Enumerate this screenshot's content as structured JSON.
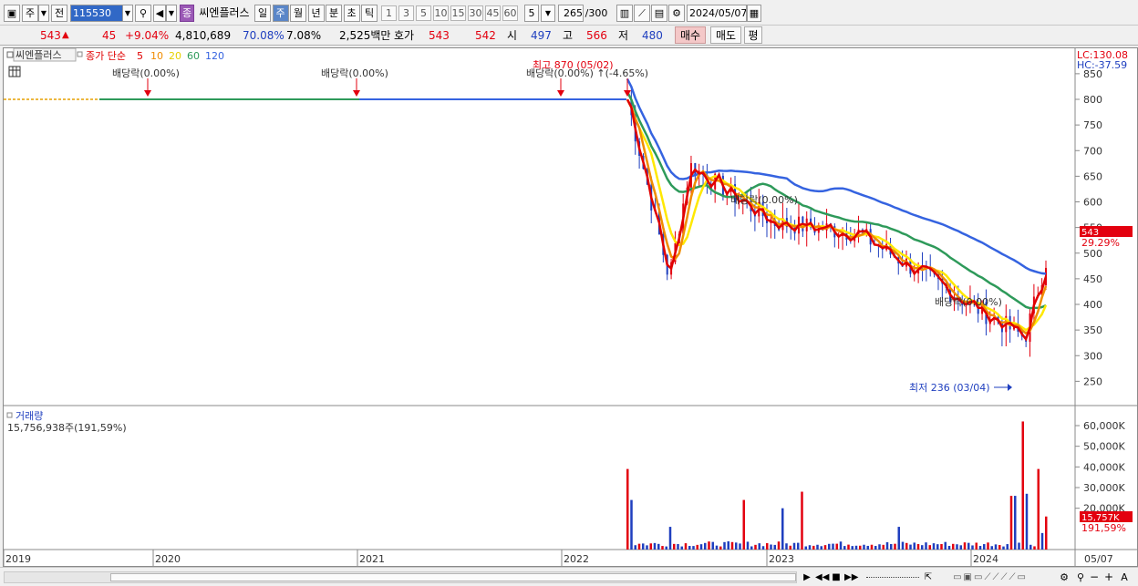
{
  "toolbar": {
    "market_label": "주",
    "prev_label": "전",
    "code": "115530",
    "company": "씨엔플러스",
    "company_badge": "종",
    "periods": [
      "일",
      "주",
      "월",
      "년",
      "분",
      "초",
      "틱"
    ],
    "active_period": "주",
    "numbers": [
      "1",
      "3",
      "5",
      "10",
      "15",
      "30",
      "45",
      "60"
    ],
    "count_select": "5",
    "page_count": "265",
    "page_total": "/300",
    "date": "2024/05/07"
  },
  "quote": {
    "price": "543",
    "arrow": "▲",
    "change": "45",
    "change_pct": "+9.04%",
    "volume": "4,810,689",
    "volume_ratio": "70.08%",
    "turnover": "7.08%",
    "amount": "2,525백만",
    "ask_label": "호가",
    "ask": "543",
    "bid": "542",
    "open_label": "시",
    "open": "497",
    "high_label": "고",
    "high": "566",
    "low_label": "저",
    "low": "480",
    "buy_label": "매수",
    "sell_label": "매도",
    "avg_label": "평"
  },
  "price_panel": {
    "stock_name": "씨엔플러스",
    "ma_label": "종가 단순",
    "ma_periods": [
      "5",
      "10",
      "20",
      "60",
      "120"
    ],
    "lc": "LC:130.08",
    "hc": "HC:-37.59",
    "y_ticks": [
      "850",
      "800",
      "750",
      "700",
      "650",
      "600",
      "550",
      "500",
      "450",
      "400",
      "350",
      "300",
      "250"
    ],
    "current_price_tag": "543",
    "current_pct_tag": "29.29%",
    "annotations": {
      "div1": "배당락(0.00%)",
      "div2": "배당락(0.00%)",
      "div3": "배당락(0.00%) ↑(-4.65%)",
      "div4": "배당락(0.00%)",
      "div5": "배당락(0.00%)",
      "high": "최고 870 (05/02)",
      "low": "최저 236 (03/04)"
    }
  },
  "volume_panel": {
    "title": "거래량",
    "value": "15,756,938주(191,59%)",
    "y_ticks": [
      "60,000K",
      "50,000K",
      "40,000K",
      "30,000K",
      "20,000K"
    ],
    "current_tag": "15,757K",
    "current_pct": "191,59%"
  },
  "x_axis": {
    "labels": [
      "2019",
      "2020",
      "2021",
      "2022",
      "2023",
      "2024",
      "05/07"
    ]
  },
  "colors": {
    "up": "#e3000f",
    "down": "#1f3fbf",
    "ma5": "#e00000",
    "ma10": "#f08c00",
    "ma20": "#ffe800",
    "ma60": "#2e9a5a",
    "ma120": "#3563e0"
  }
}
